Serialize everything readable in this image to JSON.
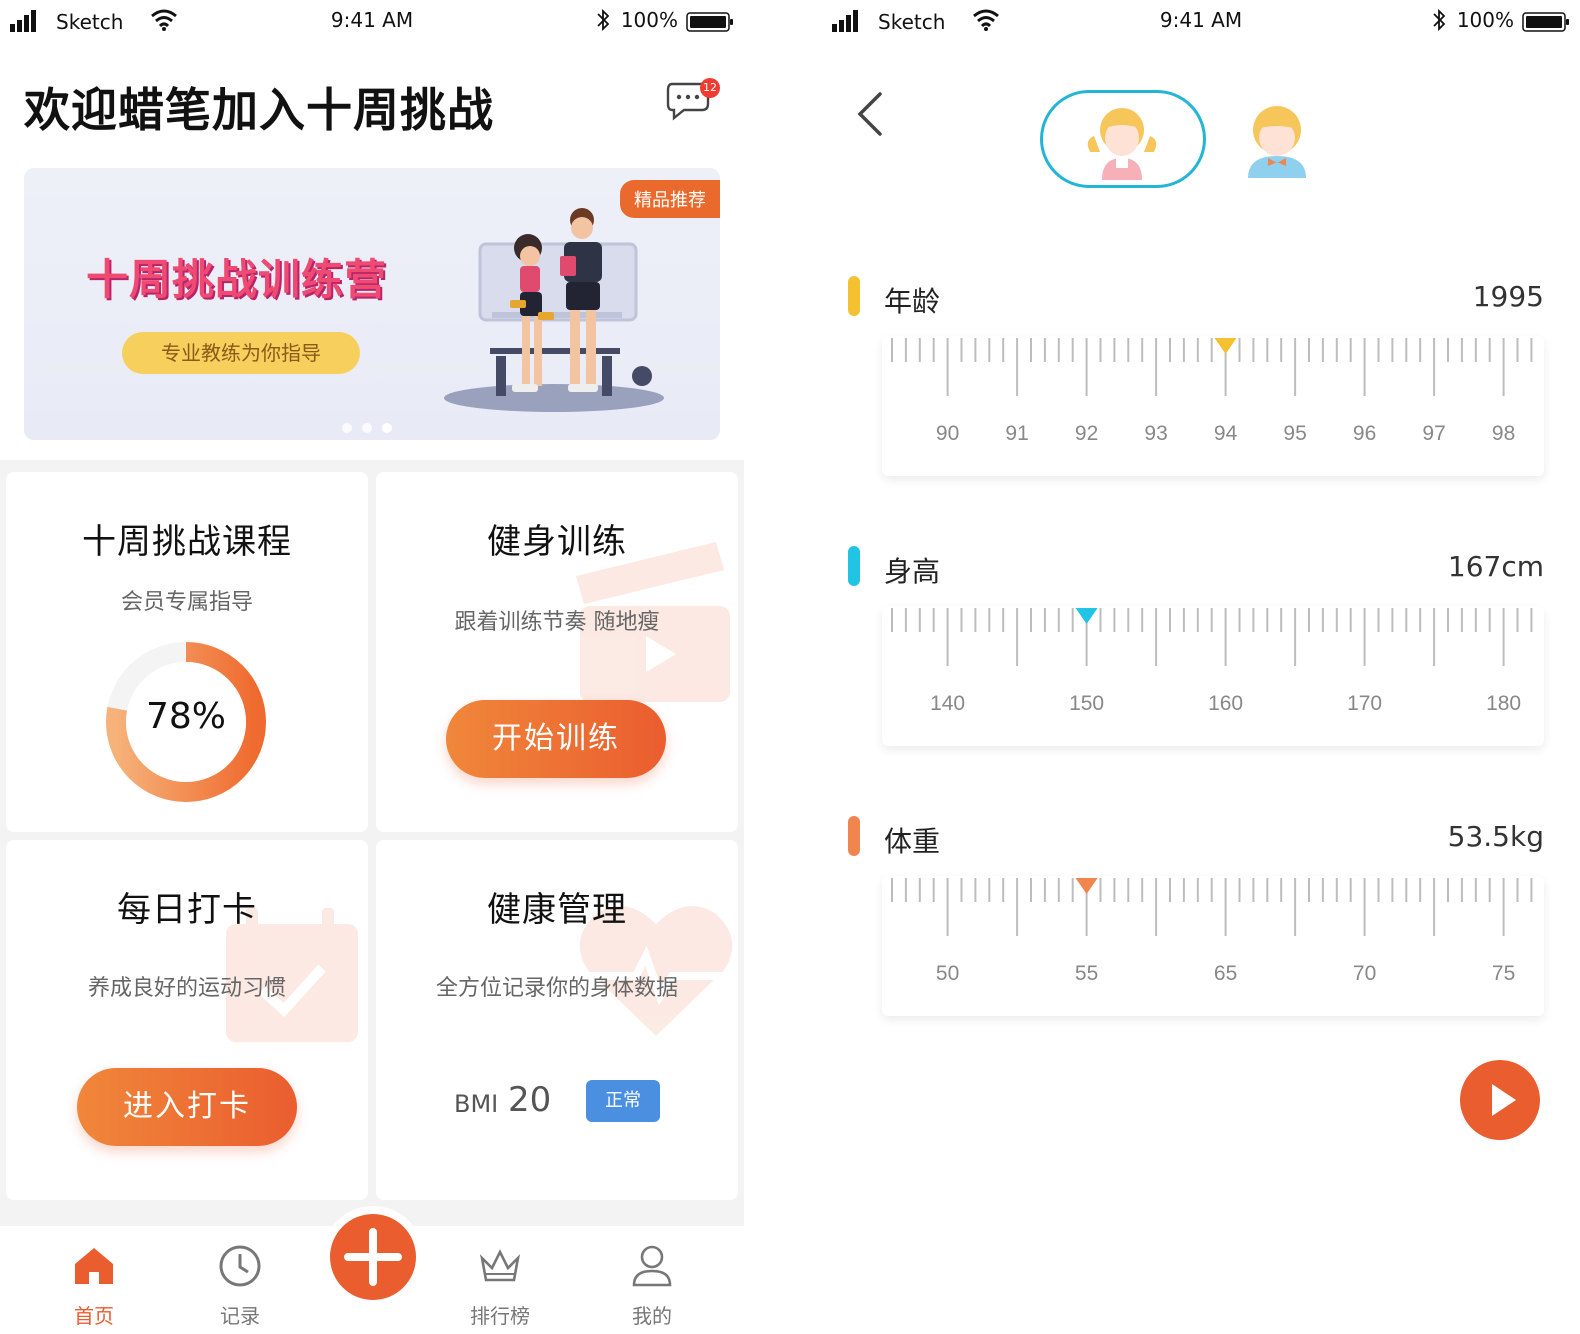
{
  "status_bar": {
    "carrier": "Sketch",
    "time": "9:41 AM",
    "battery": "100%"
  },
  "home": {
    "welcome": "欢迎蜡笔加入十周挑战",
    "message_badge": "12",
    "banner": {
      "tag": "精品推荐",
      "title": "十周挑战训练营",
      "subtitle": "专业教练为你指导",
      "active_slide": 3,
      "slide_count": 3
    },
    "cards": {
      "course": {
        "title": "十周挑战课程",
        "subtitle": "会员专属指导",
        "progress_label": "78%",
        "progress": 0.78
      },
      "training": {
        "title": "健身训练",
        "subtitle": "跟着训练节奏  随地瘦",
        "button": "开始训练"
      },
      "checkin": {
        "title": "每日打卡",
        "subtitle": "养成良好的运动习惯",
        "button": "进入打卡"
      },
      "health": {
        "title": "健康管理",
        "subtitle": "全方位记录你的身体数据",
        "bmi_label": "BMI",
        "bmi_value": "20",
        "bmi_status": "正常"
      }
    },
    "tabs": [
      {
        "label": "首页",
        "icon": "home-icon",
        "active": true
      },
      {
        "label": "记录",
        "icon": "clock-icon",
        "active": false
      },
      {
        "label": "排行榜",
        "icon": "crown-icon",
        "active": false
      },
      {
        "label": "我的",
        "icon": "user-icon",
        "active": false
      }
    ],
    "colors": {
      "accent": "#ea5d2f",
      "badge": "#4a8fe0"
    }
  },
  "profile": {
    "selected_avatar": "girl",
    "metrics": [
      {
        "label": "年龄",
        "value": "1995",
        "color": "#f6c131",
        "ticks": [
          "90",
          "91",
          "92",
          "93",
          "94",
          "95",
          "96",
          "97",
          "98"
        ],
        "pointer_color": "#f6c131"
      },
      {
        "label": "身高",
        "value": "167cm",
        "color": "#22c4e6",
        "ticks": [
          "140",
          "150",
          "160",
          "170",
          "180"
        ],
        "pointer_color": "#22c4e6"
      },
      {
        "label": "体重",
        "value": "53.5kg",
        "color": "#f0854e",
        "ticks": [
          "50",
          "55",
          "65",
          "70",
          "75"
        ],
        "pointer_color": "#f0854e"
      }
    ]
  }
}
